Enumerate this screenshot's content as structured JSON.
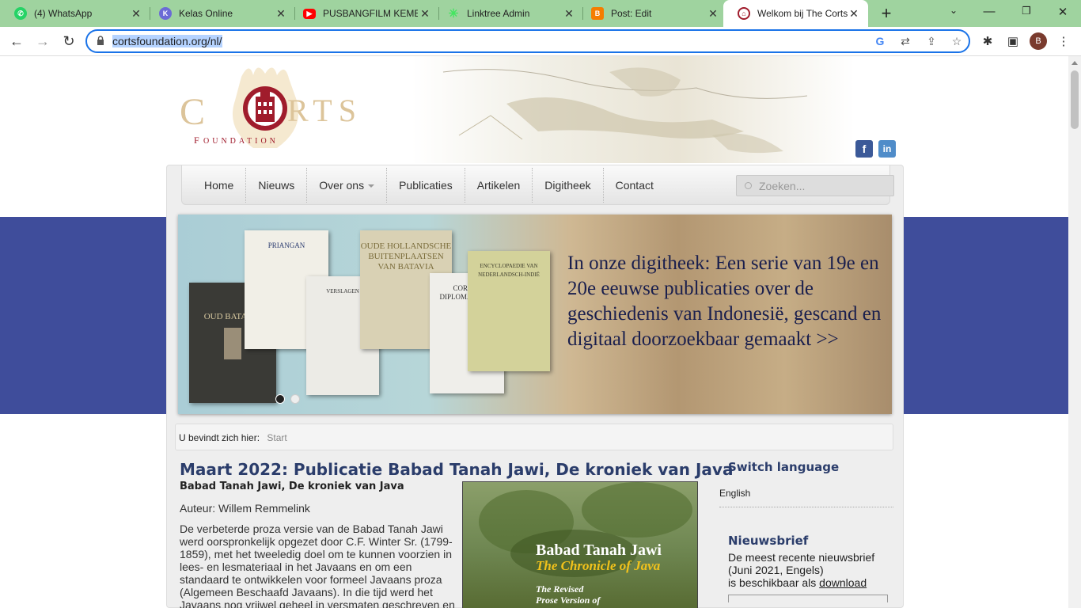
{
  "browser": {
    "tabs": [
      {
        "title": "(4) WhatsApp",
        "icon": "whatsapp-icon",
        "color": "#25d366"
      },
      {
        "title": "Kelas Online",
        "icon": "kelas-online-icon",
        "color": "#6b6bd6"
      },
      {
        "title": "PUSBANGFILM KEMEN",
        "icon": "youtube-icon",
        "color": "#ff0000"
      },
      {
        "title": "Linktree Admin",
        "icon": "linktree-icon",
        "color": "#43e660"
      },
      {
        "title": "Post: Edit",
        "icon": "blogger-icon",
        "color": "#f57d00"
      },
      {
        "title": "Welkom bij The Corts",
        "icon": "corts-icon",
        "color": "#a01c2c"
      }
    ],
    "url_highlighted": "cortsfoundation.org/nl/",
    "avatar_letter": "B"
  },
  "site": {
    "logo_text": "CORTS",
    "logo_subtext": "FOUNDATION",
    "menu": [
      "Home",
      "Nieuws",
      "Over ons",
      "Publicaties",
      "Artikelen",
      "Digitheek",
      "Contact"
    ],
    "search_placeholder": "Zoeken...",
    "slide": {
      "books": [
        "OUD BATAVIA",
        "PRIANGAN",
        "VERSLAGEN",
        "OUDE HOLLANDSCHE BUITENPLAATSEN VAN BATAVIA",
        "CORPUS DIPLOMATICUM",
        "ENCYCLOPAEDIE VAN NEDERLANDSCH-INDIË"
      ],
      "text": "In onze digitheek: Een serie van 19e en 20e eeuwse publicaties over de geschiedenis van Indonesië, gescand en digitaal doorzoekbaar gemaakt  >>"
    },
    "breadcrumb": {
      "label": "U bevindt zich hier:",
      "current": "Start"
    },
    "article": {
      "title": "Maart 2022: Publicatie Babad Tanah Jawi, De kroniek van Java",
      "subtitle": "Babad Tanah Jawi, De kroniek van Java",
      "author": "Auteur: Willem Remmelink",
      "body": "De verbeterde proza versie van de Babad Tanah Jawi werd oorspronkelijk opgezet door C.F. Winter Sr. (1799-1859), met het tweeledig doel om te kunnen voorzien in lees- en lesmateriaal in het Javaans en om een standaard te ontwikkelen voor formeel Javaans proza (Algemeen Beschaafd Javaans). In die tijd werd het Javaans nog vrijwel geheel in versmaten geschreven en"
    },
    "cover": {
      "title": "Babad Tanah Jawi",
      "subtitle": "The Chronicle of Java",
      "line3": "The Revised",
      "line4": "Prose Version of"
    },
    "sidebar": {
      "switch_language": "Switch language",
      "language": "English",
      "newsletter_title": "Nieuwsbrief",
      "newsletter_text": "De meest recente nieuwsbrief (Juni 2021, Engels)",
      "newsletter_text2": "is beschikbaar als",
      "newsletter_link": "download"
    }
  },
  "colors": {
    "tabbar": "#9fd39f",
    "band": "#3f4d9b",
    "heading": "#2b3d6b"
  }
}
